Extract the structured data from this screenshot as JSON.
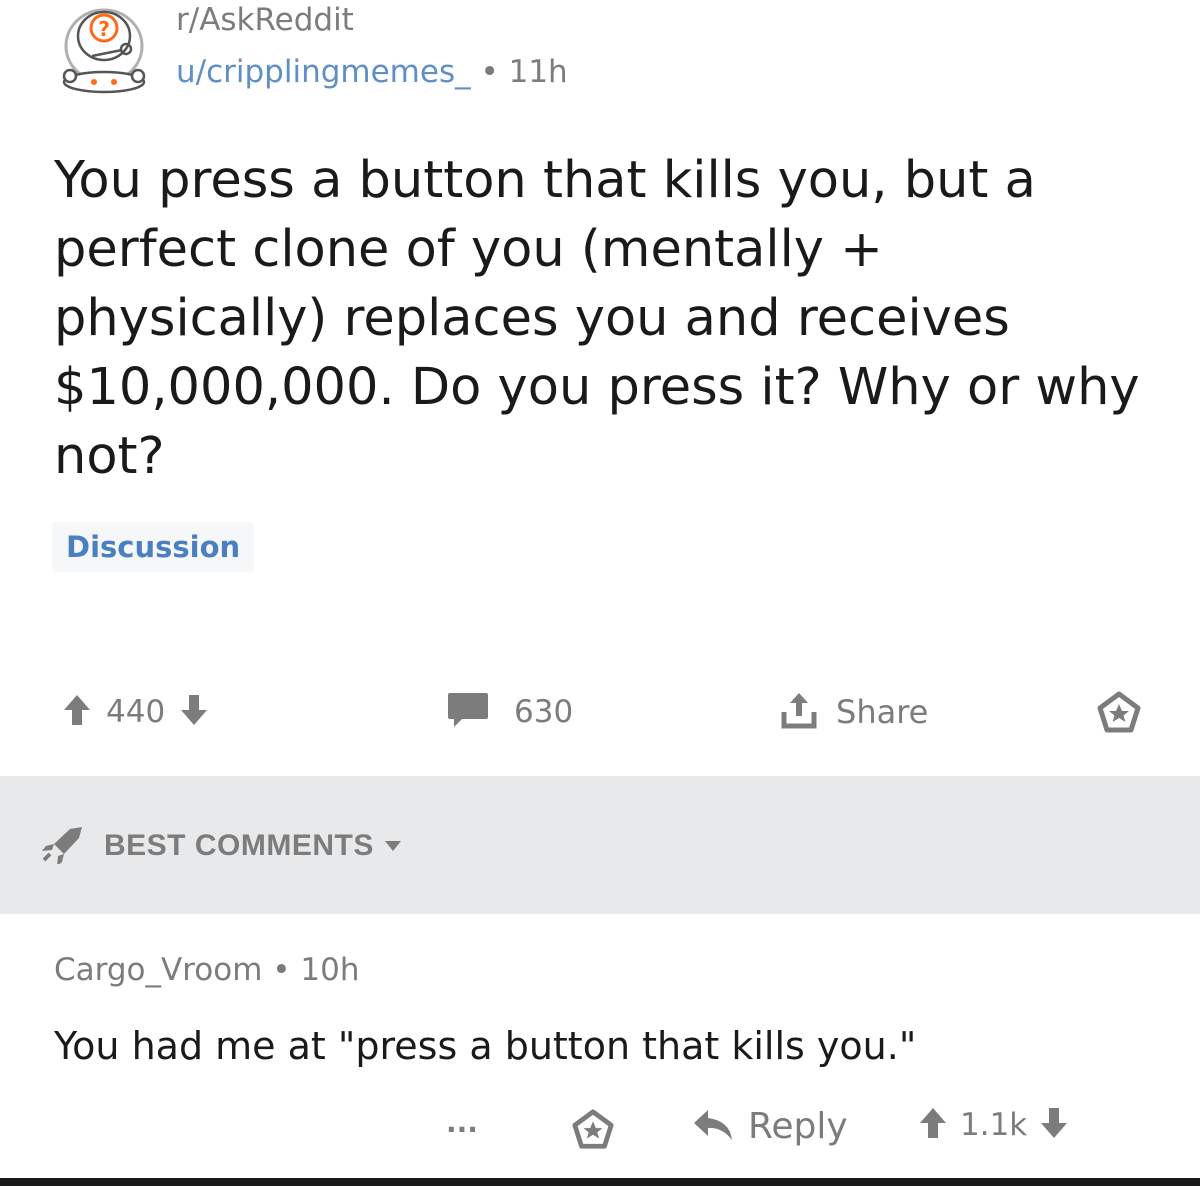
{
  "post": {
    "subreddit": "r/AskReddit",
    "author": "u/cripplingmemes_",
    "separator": "•",
    "age": "11h",
    "title": "You press a button that kills you, but a perfect clone of you (mentally + physically) replaces you and receives $10,000,000. Do you press it? Why or why not?",
    "flair": "Discussion",
    "score": "440",
    "comment_count": "630",
    "share_label": "Share"
  },
  "comments_header": {
    "sort_label": "BEST COMMENTS"
  },
  "top_comment": {
    "author": "Cargo_Vroom",
    "separator": "•",
    "age": "10h",
    "body": "You had me at \"press a button that kills you.\"",
    "more": "...",
    "reply_label": "Reply",
    "score": "1.1k"
  },
  "colors": {
    "meta_gray": "#7c7c7c",
    "link_blue": "#5f8fc5",
    "flair_blue": "#4a7fc1",
    "bar_gray": "#e8e9ea"
  },
  "icons": [
    "snoo-question-avatar-icon",
    "upvote-arrow-icon",
    "downvote-arrow-icon",
    "comment-bubble-icon",
    "share-icon",
    "save-star-icon",
    "rocket-icon",
    "caret-down-icon",
    "reply-arrow-icon"
  ]
}
